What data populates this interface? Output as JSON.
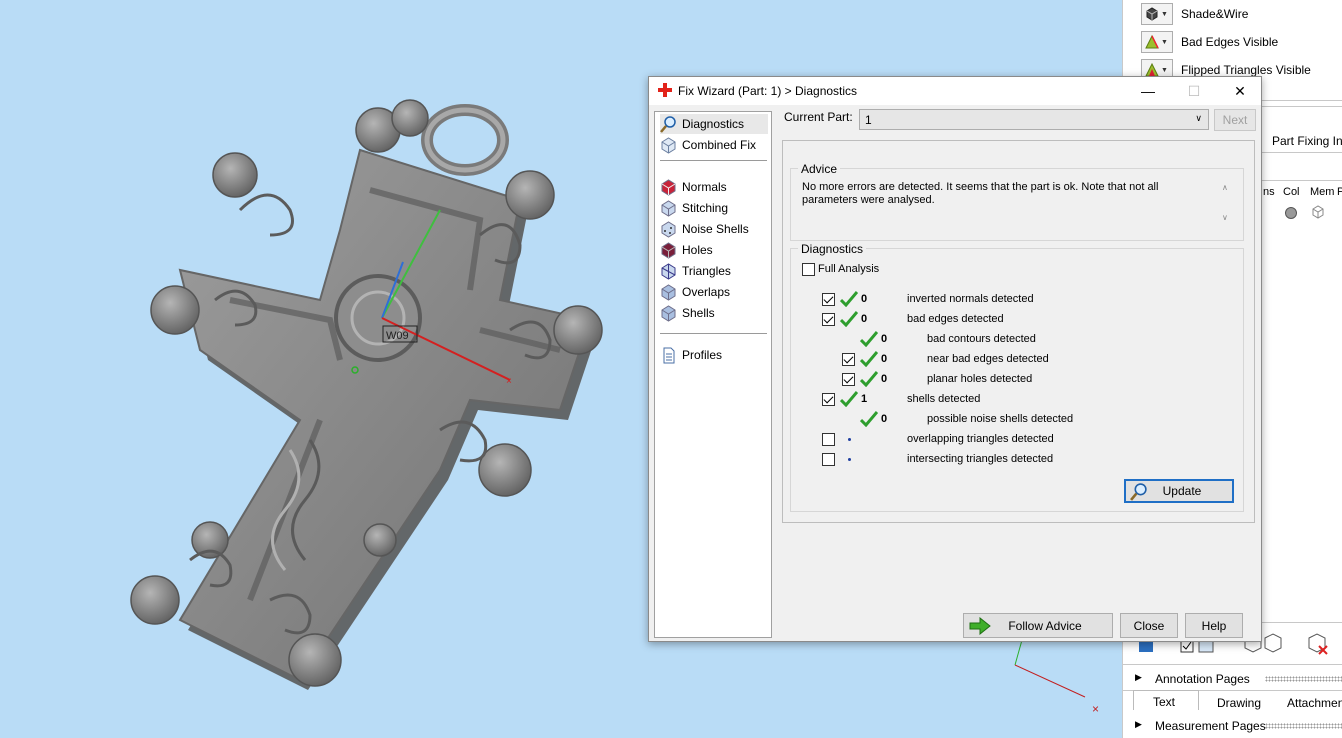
{
  "right_panel": {
    "toggles": [
      {
        "label": "Shade&Wire",
        "icon": "shade-wire-icon"
      },
      {
        "label": "Bad Edges Visible",
        "icon": "bad-edges-icon"
      },
      {
        "label": "Flipped Triangles Visible",
        "icon": "flipped-triangles-icon"
      }
    ],
    "part_fixing_tab": "Part Fixing Inf",
    "columns": [
      "ns",
      "Col",
      "Mem",
      "P"
    ],
    "annotation_pages": "Annotation Pages",
    "tabs": [
      "Text",
      "Drawing",
      "Attachmen"
    ],
    "measurement_pages": "Measurement Pages"
  },
  "viewport": {
    "label_tag": "W09",
    "colors": {
      "background": "#b9dcf6",
      "model": "#8c8c8c"
    }
  },
  "dialog": {
    "title": "Fix Wizard (Part: 1) > Diagnostics",
    "nav": {
      "top": [
        {
          "label": "Diagnostics",
          "icon": "magnifier-icon",
          "selected": true
        },
        {
          "label": "Combined Fix",
          "icon": "cube-icon"
        }
      ],
      "middle": [
        {
          "label": "Normals",
          "icon": "normals-icon"
        },
        {
          "label": "Stitching",
          "icon": "stitching-icon"
        },
        {
          "label": "Noise Shells",
          "icon": "noise-shells-icon"
        },
        {
          "label": "Holes",
          "icon": "holes-icon"
        },
        {
          "label": "Triangles",
          "icon": "triangles-icon"
        },
        {
          "label": "Overlaps",
          "icon": "overlaps-icon"
        },
        {
          "label": "Shells",
          "icon": "shells-icon"
        }
      ],
      "bottom": [
        {
          "label": "Profiles",
          "icon": "document-icon"
        }
      ]
    },
    "current_part_label": "Current Part:",
    "current_part_value": "1",
    "next_label": "Next",
    "advice_title": "Advice",
    "advice_text": "No more errors are detected. It seems that the part is ok. Note that not all parameters were analysed.",
    "diagnostics_title": "Diagnostics",
    "full_analysis_label": "Full Analysis",
    "rows": [
      {
        "checked": true,
        "status": "ok",
        "count": "0",
        "label": "inverted normals detected",
        "indent": 0
      },
      {
        "checked": true,
        "status": "ok",
        "count": "0",
        "label": "bad edges detected",
        "indent": 0
      },
      {
        "checked": null,
        "status": "ok",
        "count": "0",
        "label": "bad contours detected",
        "indent": 1
      },
      {
        "checked": true,
        "status": "ok",
        "count": "0",
        "label": "near bad edges detected",
        "indent": 1
      },
      {
        "checked": true,
        "status": "ok",
        "count": "0",
        "label": "planar holes detected",
        "indent": 1
      },
      {
        "checked": true,
        "status": "ok",
        "count": "1",
        "label": "shells detected",
        "indent": 0
      },
      {
        "checked": null,
        "status": "ok",
        "count": "0",
        "label": "possible noise shells detected",
        "indent": 1
      },
      {
        "checked": false,
        "status": "none",
        "count": "",
        "label": "overlapping triangles detected",
        "indent": 0
      },
      {
        "checked": false,
        "status": "none",
        "count": "",
        "label": "intersecting triangles detected",
        "indent": 0
      }
    ],
    "update_label": "Update",
    "follow_advice_label": "Follow Advice",
    "close_label": "Close",
    "help_label": "Help",
    "colors": {
      "check_green": "#2e9e2e",
      "accent_blue": "#1f6fc6"
    }
  }
}
